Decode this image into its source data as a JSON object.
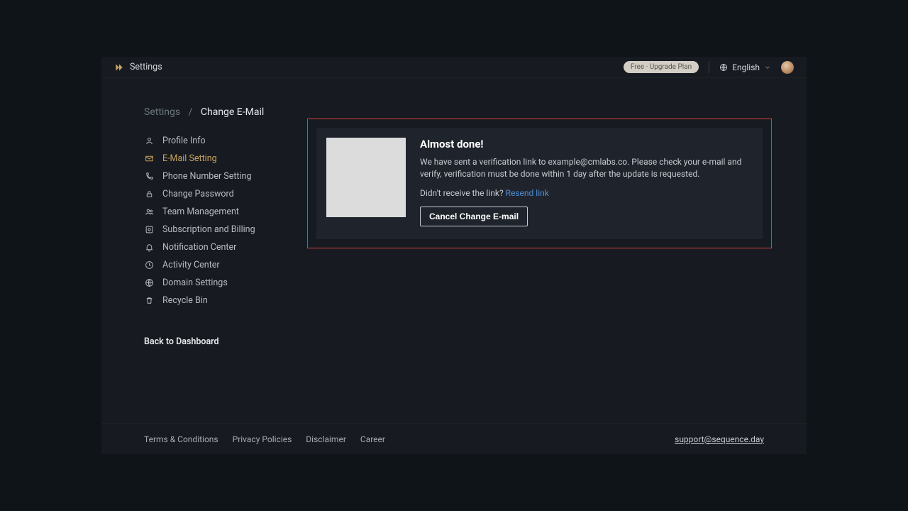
{
  "header": {
    "title": "Settings",
    "plan_badge": "Free · Upgrade Plan",
    "language": "English"
  },
  "breadcrumb": {
    "root": "Settings",
    "separator": "/",
    "current": "Change E-Mail"
  },
  "sidebar": {
    "items": [
      {
        "icon": "user-icon",
        "label": "Profile Info"
      },
      {
        "icon": "mail-icon",
        "label": "E-Mail Setting"
      },
      {
        "icon": "phone-icon",
        "label": "Phone Number Setting"
      },
      {
        "icon": "lock-icon",
        "label": "Change Password"
      },
      {
        "icon": "team-icon",
        "label": "Team Management"
      },
      {
        "icon": "billing-icon",
        "label": "Subscription and Billing"
      },
      {
        "icon": "bell-icon",
        "label": "Notification Center"
      },
      {
        "icon": "activity-icon",
        "label": "Activity Center"
      },
      {
        "icon": "globe-icon",
        "label": "Domain Settings"
      },
      {
        "icon": "trash-icon",
        "label": "Recycle Bin"
      }
    ],
    "active_index": 1,
    "back": "Back to Dashboard"
  },
  "panel": {
    "title": "Almost done!",
    "message": "We have sent a verification link to example@cmlabs.co. Please check your e-mail and verify, verification must be done within 1 day after the update is requested.",
    "resend_prefix": "Didn't receive the link? ",
    "resend_link": "Resend link",
    "cancel_button": "Cancel Change E-mail"
  },
  "footer": {
    "links": [
      "Terms & Conditions",
      "Privacy Policies",
      "Disclaimer",
      "Career"
    ],
    "support": "support@sequence.day"
  },
  "colors": {
    "accent": "#c9a35f",
    "highlight_border": "#d9413c",
    "link": "#4f8fd9"
  }
}
